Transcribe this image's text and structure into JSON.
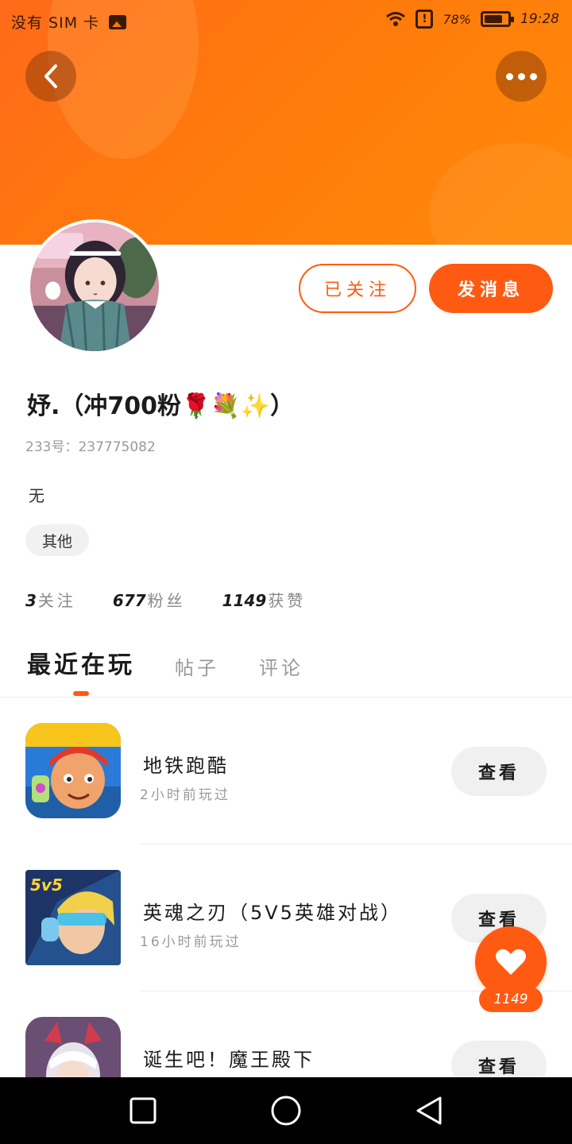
{
  "status_bar": {
    "carrier": "没有 SIM 卡",
    "battery": "78%",
    "battery_level": 0.78,
    "time": "19:28"
  },
  "header": {
    "back_icon": "chevron-left-icon",
    "more_icon": "more-dots-icon"
  },
  "profile": {
    "follow_button": "已关注",
    "message_button": "发消息",
    "username": "妤.（冲700粉🌹💐✨）",
    "user_id": "233号：237775082",
    "bio": "无",
    "tag": "其他"
  },
  "stats": [
    {
      "num": "3",
      "label": "关注"
    },
    {
      "num": "677",
      "label": "粉丝"
    },
    {
      "num": "1149",
      "label": "获赞"
    }
  ],
  "tabs": [
    {
      "label": "最近在玩",
      "active": true
    },
    {
      "label": "帖子",
      "active": false
    },
    {
      "label": "评论",
      "active": false
    }
  ],
  "games": [
    {
      "title": "地铁跑酷",
      "subtitle": "2小时前玩过",
      "button": "查看"
    },
    {
      "title": "英魂之刃（5V5英雄对战）",
      "subtitle": "16小时前玩过",
      "button": "查看"
    },
    {
      "title": "诞生吧！魔王殿下",
      "subtitle": "",
      "button": "查看"
    }
  ],
  "like": {
    "icon": "heart-icon",
    "count": "1149"
  },
  "colors": {
    "accent": "#ff5a12",
    "banner": "#ff7a0c"
  }
}
